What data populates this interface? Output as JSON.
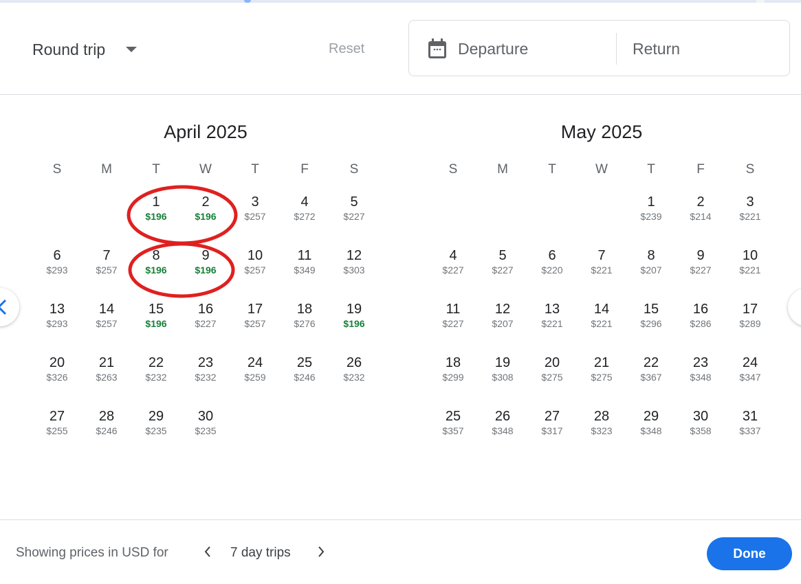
{
  "header": {
    "trip_type": "Round trip",
    "reset_label": "Reset",
    "departure_placeholder": "Departure",
    "return_placeholder": "Return"
  },
  "weekdays": [
    "S",
    "M",
    "T",
    "W",
    "T",
    "F",
    "S"
  ],
  "months": [
    {
      "title": "April 2025",
      "leading_blanks": 2,
      "days": [
        {
          "d": "1",
          "p": "$196",
          "low": true
        },
        {
          "d": "2",
          "p": "$196",
          "low": true
        },
        {
          "d": "3",
          "p": "$257"
        },
        {
          "d": "4",
          "p": "$272"
        },
        {
          "d": "5",
          "p": "$227"
        },
        {
          "d": "6",
          "p": "$293"
        },
        {
          "d": "7",
          "p": "$257"
        },
        {
          "d": "8",
          "p": "$196",
          "low": true
        },
        {
          "d": "9",
          "p": "$196",
          "low": true
        },
        {
          "d": "10",
          "p": "$257"
        },
        {
          "d": "11",
          "p": "$349"
        },
        {
          "d": "12",
          "p": "$303"
        },
        {
          "d": "13",
          "p": "$293"
        },
        {
          "d": "14",
          "p": "$257"
        },
        {
          "d": "15",
          "p": "$196",
          "low": true
        },
        {
          "d": "16",
          "p": "$227"
        },
        {
          "d": "17",
          "p": "$257"
        },
        {
          "d": "18",
          "p": "$276"
        },
        {
          "d": "19",
          "p": "$196",
          "low": true
        },
        {
          "d": "20",
          "p": "$326"
        },
        {
          "d": "21",
          "p": "$263"
        },
        {
          "d": "22",
          "p": "$232"
        },
        {
          "d": "23",
          "p": "$232"
        },
        {
          "d": "24",
          "p": "$259"
        },
        {
          "d": "25",
          "p": "$246"
        },
        {
          "d": "26",
          "p": "$232"
        },
        {
          "d": "27",
          "p": "$255"
        },
        {
          "d": "28",
          "p": "$246"
        },
        {
          "d": "29",
          "p": "$235"
        },
        {
          "d": "30",
          "p": "$235"
        }
      ]
    },
    {
      "title": "May 2025",
      "leading_blanks": 4,
      "days": [
        {
          "d": "1",
          "p": "$239"
        },
        {
          "d": "2",
          "p": "$214"
        },
        {
          "d": "3",
          "p": "$221"
        },
        {
          "d": "4",
          "p": "$227"
        },
        {
          "d": "5",
          "p": "$227"
        },
        {
          "d": "6",
          "p": "$220"
        },
        {
          "d": "7",
          "p": "$221"
        },
        {
          "d": "8",
          "p": "$207"
        },
        {
          "d": "9",
          "p": "$227"
        },
        {
          "d": "10",
          "p": "$221"
        },
        {
          "d": "11",
          "p": "$227"
        },
        {
          "d": "12",
          "p": "$207"
        },
        {
          "d": "13",
          "p": "$221"
        },
        {
          "d": "14",
          "p": "$221"
        },
        {
          "d": "15",
          "p": "$296"
        },
        {
          "d": "16",
          "p": "$286"
        },
        {
          "d": "17",
          "p": "$289"
        },
        {
          "d": "18",
          "p": "$299"
        },
        {
          "d": "19",
          "p": "$308"
        },
        {
          "d": "20",
          "p": "$275"
        },
        {
          "d": "21",
          "p": "$275"
        },
        {
          "d": "22",
          "p": "$367"
        },
        {
          "d": "23",
          "p": "$348"
        },
        {
          "d": "24",
          "p": "$347"
        },
        {
          "d": "25",
          "p": "$357"
        },
        {
          "d": "26",
          "p": "$348"
        },
        {
          "d": "27",
          "p": "$317"
        },
        {
          "d": "28",
          "p": "$323"
        },
        {
          "d": "29",
          "p": "$348"
        },
        {
          "d": "30",
          "p": "$358"
        },
        {
          "d": "31",
          "p": "$337"
        }
      ]
    }
  ],
  "footer": {
    "showing_label": "Showing prices in USD for",
    "trip_length": "7 day trips",
    "done_label": "Done"
  },
  "colors": {
    "accent": "#1a73e8",
    "low_price": "#188038",
    "annotation": "#e02020"
  },
  "annotations": [
    {
      "type": "ellipse",
      "circled_dates": "April 1-2"
    },
    {
      "type": "ellipse",
      "circled_dates": "April 8-9"
    }
  ]
}
